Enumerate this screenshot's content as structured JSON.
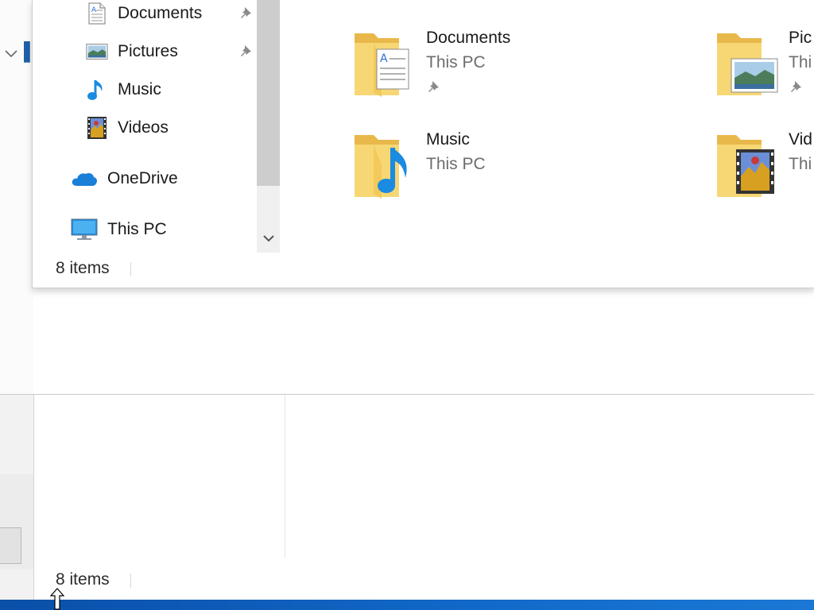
{
  "navigation": {
    "quick_access_items": [
      {
        "label": "Documents",
        "icon": "documents-icon",
        "pinned": true
      },
      {
        "label": "Pictures",
        "icon": "pictures-icon",
        "pinned": true
      },
      {
        "label": "Music",
        "icon": "music-icon",
        "pinned": false
      },
      {
        "label": "Videos",
        "icon": "videos-icon",
        "pinned": false
      }
    ],
    "onedrive": {
      "label": "OneDrive",
      "icon": "onedrive-icon"
    },
    "this_pc": {
      "label": "This PC",
      "icon": "this-pc-icon"
    }
  },
  "content": {
    "folders": [
      {
        "name": "Documents",
        "location": "This PC",
        "pinned": true,
        "icon": "documents-folder-icon"
      },
      {
        "name": "Pic",
        "location": "Thi",
        "pinned": true,
        "icon": "pictures-folder-icon"
      },
      {
        "name": "Music",
        "location": "This PC",
        "pinned": false,
        "icon": "music-folder-icon"
      },
      {
        "name": "Vid",
        "location": "Thi",
        "pinned": false,
        "icon": "videos-folder-icon"
      }
    ]
  },
  "status_bar": {
    "item_count": "8 items"
  },
  "lower_window": {
    "status_bar": {
      "item_count": "8 items"
    }
  },
  "colors": {
    "folder_yellow": "#f7d774",
    "accent_blue": "#0f78d4",
    "taskbar_blue": "#1269c9",
    "secondary_text": "#6d6d6d"
  }
}
